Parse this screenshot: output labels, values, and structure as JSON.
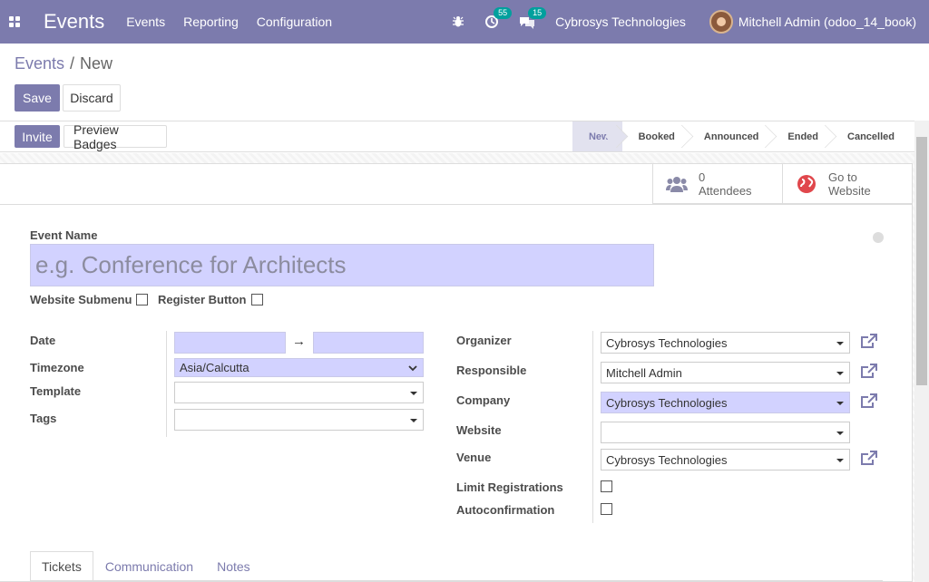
{
  "navbar": {
    "app_name": "Events",
    "menu": [
      "Events",
      "Reporting",
      "Configuration"
    ],
    "activity_count": "55",
    "message_count": "15",
    "company": "Cybrosys Technologies",
    "user": "Mitchell Admin (odoo_14_book)",
    "accent": "#7c7bad"
  },
  "breadcrumb": {
    "parent": "Events",
    "current": "New"
  },
  "actions": {
    "save": "Save",
    "discard": "Discard"
  },
  "statusbar": {
    "invite": "Invite",
    "preview_badges": "Preview Badges",
    "stages": [
      "New",
      "Booked",
      "Announced",
      "Ended",
      "Cancelled"
    ],
    "current_stage": "New"
  },
  "smart_buttons": {
    "attendees_count": "0",
    "attendees_label": "Attendees",
    "website_line1": "Go to",
    "website_line2": "Website"
  },
  "form": {
    "event_name_label": "Event Name",
    "event_name_placeholder": "e.g. Conference for Architects",
    "website_submenu": "Website Submenu",
    "register_button": "Register Button",
    "left": {
      "date_label": "Date",
      "timezone_label": "Timezone",
      "timezone_value": "Asia/Calcutta",
      "template_label": "Template",
      "tags_label": "Tags"
    },
    "right": {
      "organizer_label": "Organizer",
      "organizer_value": "Cybrosys Technologies",
      "responsible_label": "Responsible",
      "responsible_value": "Mitchell Admin",
      "company_label": "Company",
      "company_value": "Cybrosys Technologies",
      "website_label": "Website",
      "venue_label": "Venue",
      "venue_value": "Cybrosys Technologies",
      "limit_label": "Limit Registrations",
      "autoconfirm_label": "Autoconfirmation"
    }
  },
  "tabs": [
    "Tickets",
    "Communication",
    "Notes"
  ]
}
